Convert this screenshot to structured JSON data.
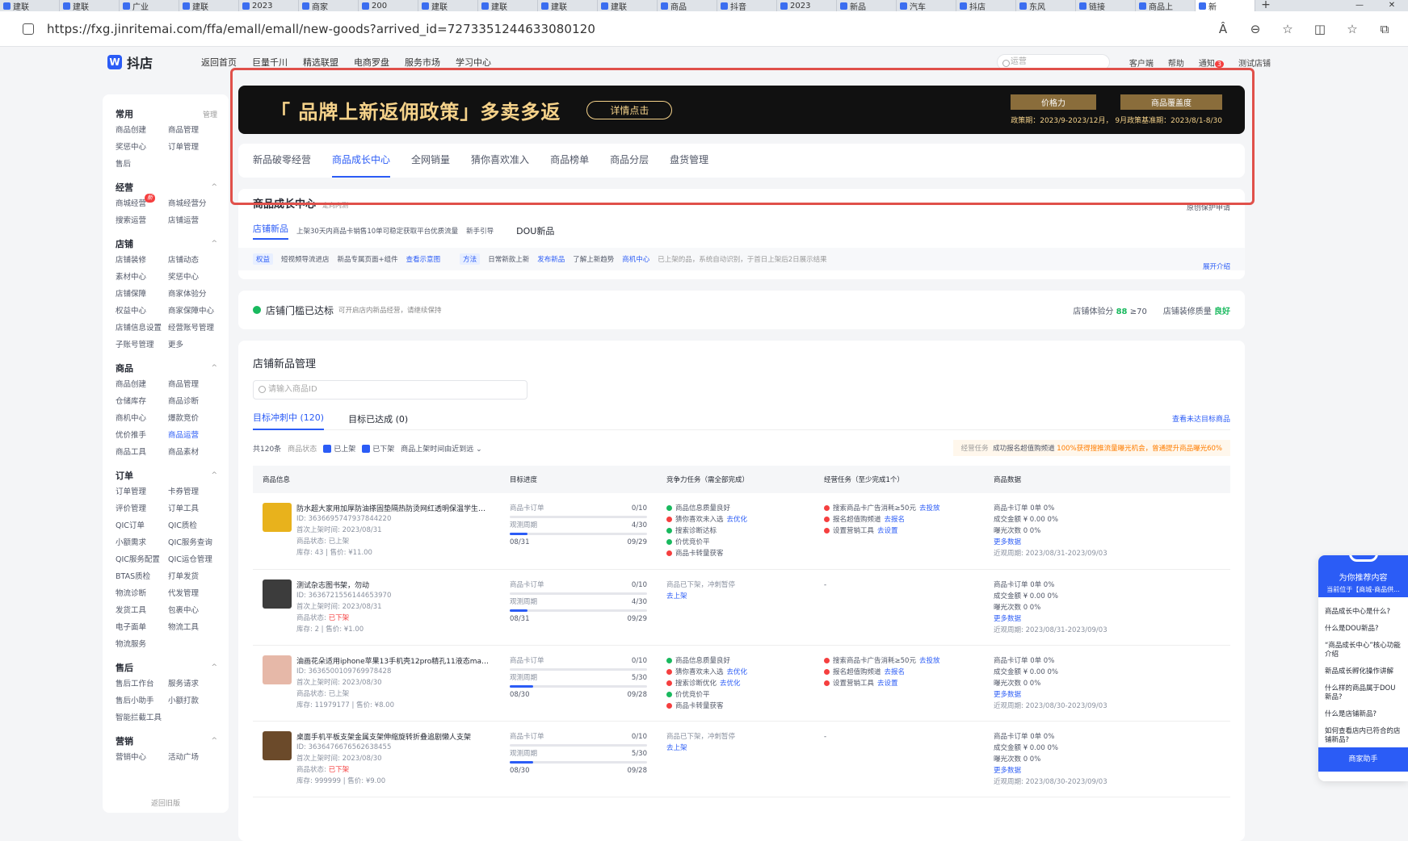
{
  "browser": {
    "tabs": [
      "建联",
      "建联",
      "广业",
      "建联",
      "2023",
      "商家",
      "200",
      "建联",
      "建联",
      "建联",
      "建联",
      "商品",
      "抖音",
      "2023",
      "新品",
      "汽车",
      "抖店",
      "东风",
      "链接",
      "商品上",
      "新"
    ],
    "new_tab": "+",
    "url": "https://fxg.jinritemai.com/ffa/emall/emall/new-goods?arrived_id=7273351244633080120",
    "win_minimize": "—",
    "win_close": "✕",
    "tools": [
      "Â",
      "⊖",
      "☆",
      "◫",
      "☆",
      "⧉"
    ]
  },
  "header": {
    "logo_text": "抖店",
    "logo_mark": "W",
    "nav": [
      "返回首页",
      "巨量千川",
      "精选联盟",
      "电商罗盘",
      "服务市场",
      "学习中心"
    ],
    "search_placeholder": "运营",
    "right": [
      "客户端",
      "帮助",
      "通知"
    ],
    "notice_badge": "3",
    "shop_name": "测试店铺"
  },
  "sidebar": {
    "groups": [
      {
        "title": "常用",
        "right": "管理",
        "items": [
          "商品创建",
          "商品管理",
          "奖惩中心",
          "订单管理",
          "售后"
        ]
      },
      {
        "title": "经营",
        "right": "^",
        "items": [
          "商城经营",
          "商城经营分",
          "搜索运营",
          "店铺运营"
        ],
        "tag": "新"
      },
      {
        "title": "店铺",
        "right": "^",
        "items": [
          "店铺装修",
          "店铺动态",
          "素材中心",
          "奖惩中心",
          "店铺保障",
          "商家体验分",
          "权益中心",
          "商家保障中心",
          "店铺信息设置",
          "经营账号管理",
          "子账号管理",
          "更多"
        ]
      },
      {
        "title": "商品",
        "right": "^",
        "items": [
          "商品创建",
          "商品管理",
          "仓储库存",
          "商品诊断",
          "商机中心",
          "爆款竞价",
          "优价推手",
          "商品运营",
          "商品工具",
          "商品素材"
        ]
      },
      {
        "title": "订单",
        "right": "^",
        "items": [
          "订单管理",
          "卡券管理",
          "评价管理",
          "订单工具",
          "QIC订单",
          "QIC质检",
          "小额需求",
          "QIC服务查询",
          "QIC服务配置",
          "QIC运仓管理",
          "BTAS质检",
          "打单发货",
          "物流诊断",
          "代发管理",
          "发货工具",
          "包裹中心",
          "电子面单",
          "物流工具",
          "物流服务"
        ]
      },
      {
        "title": "售后",
        "right": "^",
        "items": [
          "售后工作台",
          "服务请求",
          "售后小助手",
          "小额打款",
          "智能拦截工具"
        ]
      },
      {
        "title": "营销",
        "right": "^",
        "items": [
          "营销中心",
          "活动广场"
        ]
      }
    ],
    "bottom": "返回旧版"
  },
  "banner": {
    "title": "「 品牌上新返佣政策」多卖多返",
    "button": "详情点击",
    "chips": [
      "价格力",
      "商品覆盖度"
    ],
    "period": "政策期：2023/9-2023/12月，  9月政策基准期：2023/8/1-8/30"
  },
  "main_tabs": [
    "新品破零经营",
    "商品成长中心",
    "全网销量",
    "猜你喜欢准入",
    "商品榜单",
    "商品分层",
    "盘货管理"
  ],
  "growth": {
    "title": "商品成长中心",
    "subtitle": "定向内测",
    "protect": "原创保护申请",
    "tabs": [
      "店铺新品",
      "DOU新品"
    ],
    "tab_desc": "上架30天内商品卡销售10单可稳定获取平台优质流量",
    "guide": "新手引导",
    "info": {
      "label1": "权益",
      "benefit1": "短视频导流进店",
      "benefit2": "新品专属页面+组件",
      "link1": "查看示意图",
      "label2": "方法",
      "method": "日常新款上新",
      "link2": "发布新品",
      "trend": "了解上新趋势",
      "link3": "商机中心",
      "note": "已上架的品，系统自动识别，于首日上架后2日展示结果"
    },
    "expand": "展开介绍"
  },
  "status": {
    "text": "店铺门槛已达标",
    "sub": "可开启店内新品经营，请继续保持",
    "score_label": "店铺体验分",
    "score": "88",
    "score_min": "≥70",
    "quality_label": "店铺装修质量",
    "quality": "良好"
  },
  "management": {
    "title": "店铺新品管理",
    "search_placeholder": "请输入商品ID",
    "tabs": [
      "目标冲刺中 (120)",
      "目标已达成  (0)"
    ],
    "right_link": "查看未达目标商品",
    "count": "共120条",
    "state_label": "商品状态",
    "checks": [
      "已上架",
      "已下架"
    ],
    "sort": "商品上架时间由近到远",
    "tip_label": "经营任务",
    "tip_text": "成功报名超值购频道",
    "tip_highlight": "100%获得搜推流量曝光机会，",
    "tip_tail": "曾通提升商品曝光60%",
    "columns": [
      "商品信息",
      "目标进度",
      "竞争力任务（需全部完成）",
      "经营任务（至少完成1个）",
      "商品数据"
    ],
    "rows": [
      {
        "title": "防水超大家用加厚防油搽固垫隔热防烫网红透明保温学生大...",
        "id": "ID: 3636695747937844220",
        "first": "首次上架时间: 2023/08/31",
        "state_label": "商品状态: ",
        "state": "已上架",
        "stock": "库存: 43  |  售价: ¥11.00",
        "goal_label": "商品卡订单",
        "goal_value": "0/10",
        "goal_progress": 0,
        "cycle_label": "观测周期",
        "cycle_value": "4/30",
        "cycle_progress": 0.13,
        "start": "08/31",
        "end": "09/29",
        "tasks": [
          {
            "text": "商品信息质量良好",
            "status": "done",
            "link": ""
          },
          {
            "text": "猜你喜欢未入选",
            "status": "fail",
            "link": "去优化"
          },
          {
            "text": "搜索诊断达标",
            "status": "done",
            "link": ""
          },
          {
            "text": "价优竞价平",
            "status": "done",
            "link": ""
          },
          {
            "text": "商品卡转量获客",
            "status": "fail",
            "link": ""
          }
        ],
        "ops": [
          {
            "text": "搜索商品卡广告消耗≥50元",
            "link": "去投放"
          },
          {
            "text": "报名超值购频道",
            "link": "去报名"
          },
          {
            "text": "设置营销工具",
            "link": "去设置"
          }
        ],
        "stats": [
          "商品卡订单  0单  0%",
          "成交金额  ¥ 0.00  0%",
          "曝光次数  0  0%"
        ],
        "more": "更多数据",
        "range": "近观周期:  2023/08/31-2023/09/03",
        "thumb": "#e8b21c"
      },
      {
        "title": "测试杂志图书架，勿动",
        "id": "ID: 3636721556144653970",
        "first": "首次上架时间: 2023/08/31",
        "state_label": "商品状态: ",
        "state": "已下架",
        "stock": "库存: 2  |  售价: ¥1.00",
        "goal_label": "商品卡订单",
        "goal_value": "0/10",
        "goal_progress": 0,
        "cycle_label": "观测周期",
        "cycle_value": "4/30",
        "cycle_progress": 0.13,
        "start": "08/31",
        "end": "09/29",
        "note": "商品已下架，冲刺暂停",
        "note_link": "去上架",
        "ops_empty": "-",
        "stats": [
          "商品卡订单  0单  0%",
          "成交金额  ¥ 0.00  0%",
          "曝光次数  0  0%"
        ],
        "more": "更多数据",
        "range": "近观周期:  2023/08/31-2023/09/03",
        "thumb": "#3c3c3c"
      },
      {
        "title": "油画花朵适用iphone苹果13手机壳12pro精孔11液态max...",
        "id": "ID: 3636500109769978428",
        "first": "首次上架时间: 2023/08/30",
        "state_label": "商品状态: ",
        "state": "已上架",
        "stock": "库存: 11979177  |  售价: ¥8.00",
        "goal_label": "商品卡订单",
        "goal_value": "0/10",
        "goal_progress": 0,
        "cycle_label": "观测周期",
        "cycle_value": "5/30",
        "cycle_progress": 0.17,
        "start": "08/30",
        "end": "09/28",
        "tasks": [
          {
            "text": "商品信息质量良好",
            "status": "done",
            "link": ""
          },
          {
            "text": "猜你喜欢未入选",
            "status": "fail",
            "link": "去优化"
          },
          {
            "text": "搜索诊断优化",
            "status": "fail",
            "link": "去优化"
          },
          {
            "text": "价优竞价平",
            "status": "done",
            "link": ""
          },
          {
            "text": "商品卡转量获客",
            "status": "fail",
            "link": ""
          }
        ],
        "ops": [
          {
            "text": "搜索商品卡广告消耗≥50元",
            "link": "去投放"
          },
          {
            "text": "报名超值购频道",
            "link": "去报名"
          },
          {
            "text": "设置营销工具",
            "link": "去设置"
          }
        ],
        "stats": [
          "商品卡订单  0单  0%",
          "成交金额  ¥ 0.00  0%",
          "曝光次数  0  0%"
        ],
        "more": "更多数据",
        "range": "近观周期:  2023/08/30-2023/09/03",
        "thumb": "#e6b8a8"
      },
      {
        "title": "桌面手机平板支架金属支架伸缩旋转折叠追剧懒人支架",
        "id": "ID: 3636476676562638455",
        "first": "首次上架时间: 2023/08/30",
        "state_label": "商品状态: ",
        "state": "已下架",
        "stock": "库存: 999999  |  售价: ¥9.00",
        "goal_label": "商品卡订单",
        "goal_value": "0/10",
        "goal_progress": 0,
        "cycle_label": "观测周期",
        "cycle_value": "5/30",
        "cycle_progress": 0.17,
        "start": "08/30",
        "end": "09/28",
        "note": "商品已下架，冲刺暂停",
        "note_link": "去上架",
        "ops_empty": "-",
        "stats": [
          "商品卡订单  0单  0%",
          "成交金额  ¥ 0.00  0%",
          "曝光次数  0  0%"
        ],
        "more": "更多数据",
        "range": "近观周期:  2023/08/30-2023/09/03",
        "thumb": "#6b4a2a"
      }
    ]
  },
  "assistant": {
    "title": "为你推荐内容",
    "subtitle": "当前位于【商城-商品供...",
    "questions": [
      "商品成长中心是什么?",
      "什么是DOU新品?",
      "“商品成长中心”核心功能介绍",
      "新品成长孵化操作讲解",
      "什么样的商品属于DOU新品?",
      "什么是店铺新品?",
      "如何查看店内已符合的店铺新品?"
    ],
    "button": "商家助手"
  },
  "colors": {
    "accent": "#2b5cf6",
    "success": "#19b95e",
    "danger": "#f53f3f",
    "highlight_border": "#e0504a"
  }
}
